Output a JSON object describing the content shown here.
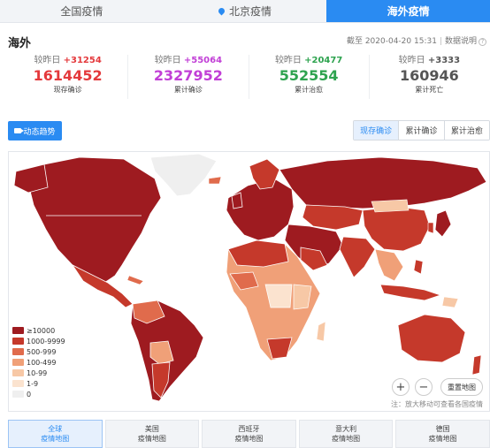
{
  "tabs": [
    {
      "label": "全国疫情"
    },
    {
      "label": "北京疫情"
    },
    {
      "label": "海外疫情"
    }
  ],
  "header": {
    "title": "海外",
    "date": "截至 2020-04-20 15:31",
    "data_note": "数据说明"
  },
  "stats": [
    {
      "delta_label": "较昨日",
      "delta": "+31254",
      "value": "1614452",
      "label": "现存确诊",
      "color": "#e4393c"
    },
    {
      "delta_label": "较昨日",
      "delta": "+55064",
      "value": "2327952",
      "label": "累计确诊",
      "color": "#c13fd6"
    },
    {
      "delta_label": "较昨日",
      "delta": "+20477",
      "value": "552554",
      "label": "累计治愈",
      "color": "#2ea34f"
    },
    {
      "delta_label": "较昨日",
      "delta": "+3333",
      "value": "160946",
      "label": "累计死亡",
      "color": "#555555"
    }
  ],
  "trend_button": "动态趋势",
  "view_toggle": [
    "现存确诊",
    "累计确诊",
    "累计治愈"
  ],
  "legend": [
    {
      "label": "≥10000",
      "color": "#9e1b20"
    },
    {
      "label": "1000-9999",
      "color": "#c5392b"
    },
    {
      "label": "500-999",
      "color": "#e06b4c"
    },
    {
      "label": "100-499",
      "color": "#f0a078"
    },
    {
      "label": "10-99",
      "color": "#f7c8a6"
    },
    {
      "label": "1-9",
      "color": "#fbe3cf"
    },
    {
      "label": "0",
      "color": "#efefef"
    }
  ],
  "map_controls": {
    "zoom_in": "+",
    "zoom_out": "−",
    "reset": "重置地图",
    "note": "注：放大移动可查看各国疫情"
  },
  "bottom_tabs": [
    {
      "line1": "全球",
      "line2": "疫情地图"
    },
    {
      "line1": "美国",
      "line2": "疫情地图"
    },
    {
      "line1": "西班牙",
      "line2": "疫情地图"
    },
    {
      "line1": "意大利",
      "line2": "疫情地图"
    },
    {
      "line1": "德国",
      "line2": "疫情地图"
    }
  ]
}
